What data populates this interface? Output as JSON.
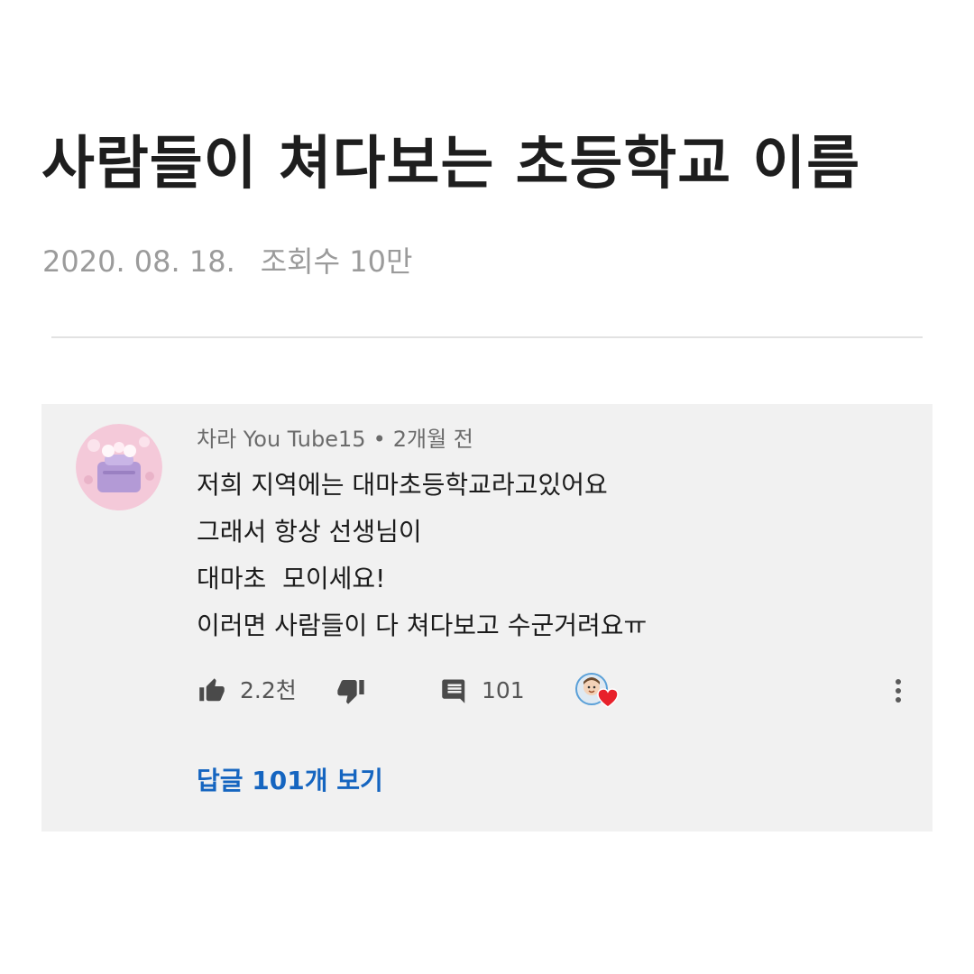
{
  "post": {
    "title": "사람들이 쳐다보는 초등학교 이름",
    "date": "2020. 08. 18.",
    "views": "조회수 10만"
  },
  "comment": {
    "author": "차라 You Tube15",
    "separator": "•",
    "time": "2개월 전",
    "lines": [
      "저희 지역에는 대마초등학교라고있어요",
      "그래서 항상 선생님이",
      "대마초  모이세요!",
      "이러면 사람들이 다 쳐다보고 수군거려요ㅠ"
    ],
    "likes": "2.2천",
    "reply_count": "101",
    "view_replies": "답글 101개 보기",
    "icons": {
      "like": "thumb-up-icon",
      "dislike": "thumb-down-icon",
      "reply": "comment-icon",
      "creator_heart": "creator-heart-icon",
      "more": "more-vert-icon"
    },
    "colors": {
      "card_bg": "#f1f1f1",
      "link": "#1565c0",
      "heart": "#e8212b"
    }
  }
}
